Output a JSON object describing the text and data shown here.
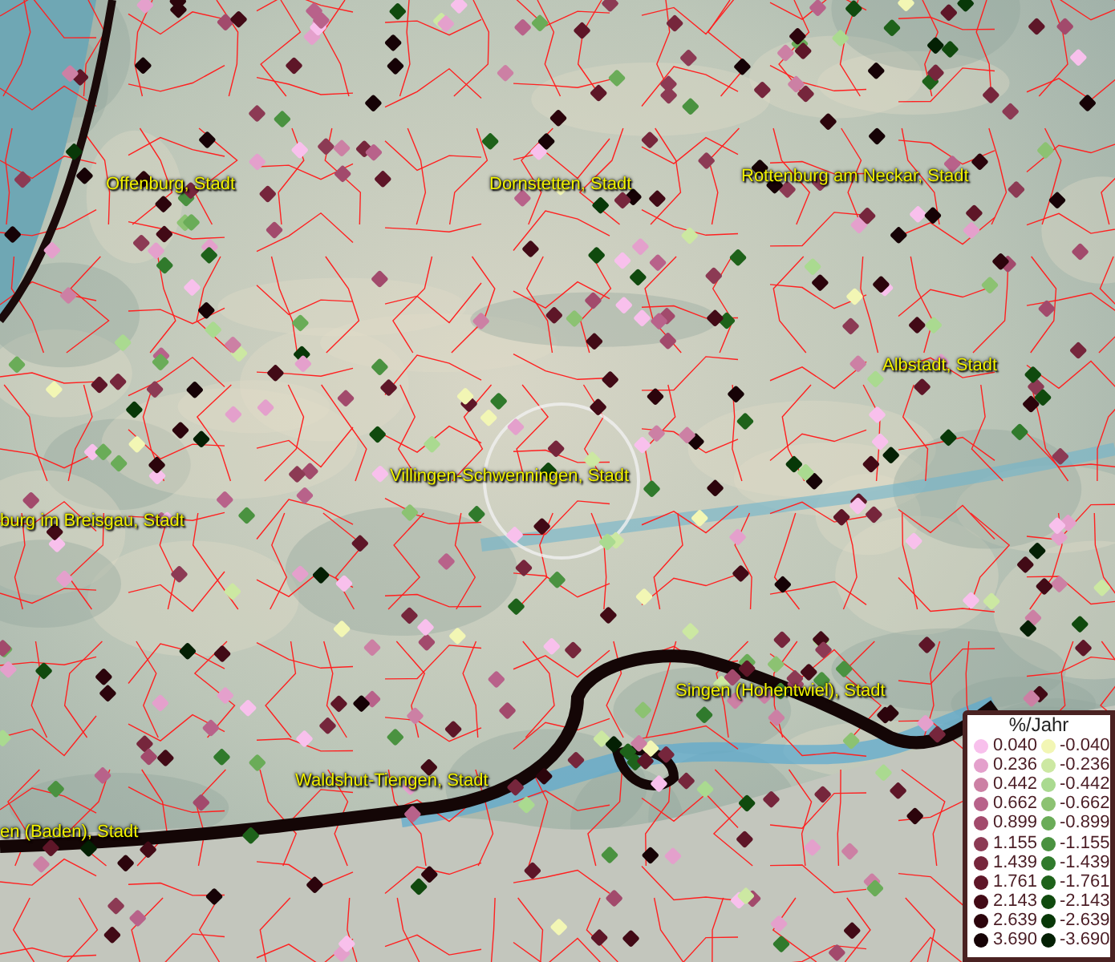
{
  "map": {
    "places": [
      {
        "label": "Offenburg, Stadt"
      },
      {
        "label": "Dornstetten, Stadt"
      },
      {
        "label": "Rottenburg am Neckar, Stadt"
      },
      {
        "label": "Albstadt, Stadt"
      },
      {
        "label": "Villingen-Schwenningen, Stadt"
      },
      {
        "label": "burg im Breisgau, Stadt"
      },
      {
        "label": "Singen (Hohentwiel), Stadt"
      },
      {
        "label": "Waldshut-Tiengen, Stadt"
      },
      {
        "label": "en (Baden), Stadt"
      }
    ]
  },
  "legend": {
    "title": "%/Jahr",
    "positive": [
      {
        "label": "0.040",
        "color": "#f8c0ec"
      },
      {
        "label": "0.236",
        "color": "#e4a0cc"
      },
      {
        "label": "0.442",
        "color": "#cc80a4"
      },
      {
        "label": "0.662",
        "color": "#b8628a"
      },
      {
        "label": "0.899",
        "color": "#a24a6c"
      },
      {
        "label": "1.155",
        "color": "#8c3a54"
      },
      {
        "label": "1.439",
        "color": "#76263c"
      },
      {
        "label": "1.761",
        "color": "#5e1628"
      },
      {
        "label": "2.143",
        "color": "#420a16"
      },
      {
        "label": "2.639",
        "color": "#2c040c"
      },
      {
        "label": "3.690",
        "color": "#160206"
      }
    ],
    "negative": [
      {
        "label": "-0.040",
        "color": "#f2f6b4"
      },
      {
        "label": "-0.236",
        "color": "#cce8a2"
      },
      {
        "label": "-0.442",
        "color": "#aada90"
      },
      {
        "label": "-0.662",
        "color": "#8cc272"
      },
      {
        "label": "-0.899",
        "color": "#6aac58"
      },
      {
        "label": "-1.155",
        "color": "#4a9240"
      },
      {
        "label": "-1.439",
        "color": "#307a2c"
      },
      {
        "label": "-1.761",
        "color": "#1e621a"
      },
      {
        "label": "-2.143",
        "color": "#104a0e"
      },
      {
        "label": "-2.639",
        "color": "#083808"
      },
      {
        "label": "-3.690",
        "color": "#042004"
      }
    ]
  }
}
